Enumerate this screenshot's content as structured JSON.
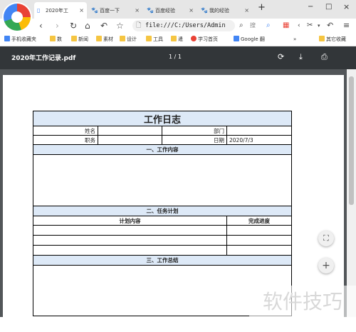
{
  "tabs": [
    {
      "label": "2020年工",
      "icon": "file-icon",
      "active": true
    },
    {
      "label": "百度一下",
      "icon": "baidu-icon",
      "active": false
    },
    {
      "label": "百度经验",
      "icon": "baidu-icon",
      "active": false
    },
    {
      "label": "我的经验",
      "icon": "baidu-icon",
      "active": false
    }
  ],
  "new_tab": "+",
  "window": {
    "minimize": "−",
    "maximize": "□",
    "close": "×"
  },
  "address": {
    "url": "file:///C:/Users/Admin"
  },
  "nav": {
    "search_label": "搜"
  },
  "bookmarks": [
    {
      "label": "手机收藏夹"
    },
    {
      "label": "数"
    },
    {
      "label": "新闻"
    },
    {
      "label": "素材"
    },
    {
      "label": "设计"
    },
    {
      "label": "工具"
    },
    {
      "label": "遣"
    },
    {
      "label": "学习首页"
    },
    {
      "label": "Google 翻"
    },
    {
      "label": "其它收藏"
    }
  ],
  "pdf": {
    "filename": "2020年工作记录.pdf",
    "page_indicator": "1 / 1"
  },
  "doc": {
    "title": "工作日志",
    "name_label": "姓名",
    "dept_label": "部门",
    "position_label": "职务",
    "date_label": "日期",
    "date_value": "2020/7/3",
    "section1": "一、工作内容",
    "section2": "二、任务计划",
    "plan_col1": "计划内容",
    "plan_col2": "完成进度",
    "section3": "三、工作总结"
  },
  "watermark": "软件技巧",
  "colors": {
    "pdf_toolbar": "#323639",
    "viewer_bg": "#525659",
    "header_fill": "#dde9f7"
  }
}
